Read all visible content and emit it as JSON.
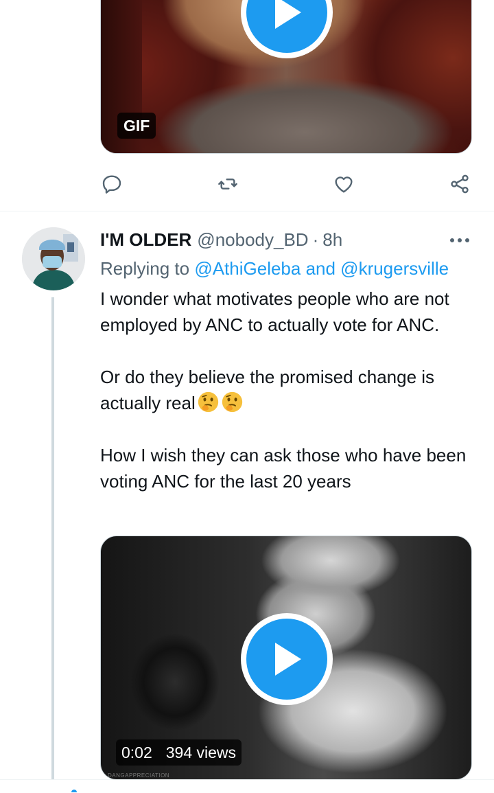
{
  "previous_tweet": {
    "gif_label": "GIF"
  },
  "actions": {
    "reply_icon": "reply-icon",
    "retweet_icon": "retweet-icon",
    "like_icon": "heart-icon",
    "share_icon": "share-icon"
  },
  "tweet": {
    "display_name": "I'M OLDER",
    "handle": "@nobody_BD",
    "separator": "·",
    "time": "8h",
    "replying_prefix": "Replying to",
    "replying_users": "@AthiGeleba and @krugersville",
    "paragraph_1": "I wonder what motivates people who are not employed by ANC to actually vote for ANC.",
    "paragraph_2": "Or do they believe the promised change is actually real",
    "paragraph_2_emojis": [
      "thinking-face",
      "thinking-face"
    ],
    "paragraph_3": "How I wish they can ask those who have been voting ANC for the last 20 years",
    "video": {
      "duration": "0:02",
      "views": "394 views",
      "watermark": "DANGAPPRECIATION"
    }
  },
  "colors": {
    "accent": "#1d9bf0",
    "text_primary": "#0f1419",
    "text_secondary": "#536471",
    "border": "#cfd9de"
  }
}
